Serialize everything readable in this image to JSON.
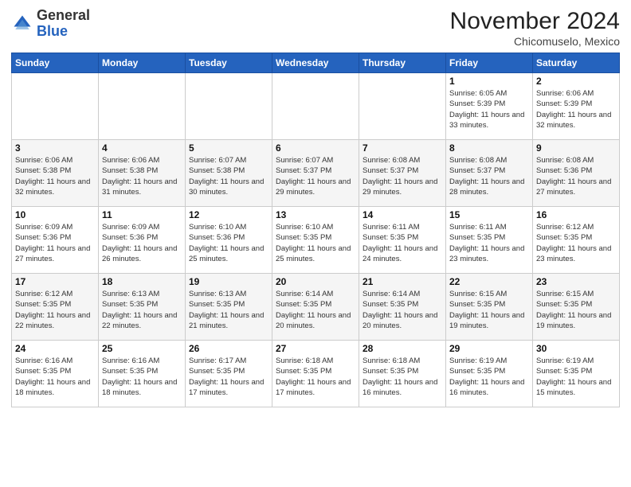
{
  "header": {
    "logo_general": "General",
    "logo_blue": "Blue",
    "month_title": "November 2024",
    "location": "Chicomuselo, Mexico"
  },
  "days_of_week": [
    "Sunday",
    "Monday",
    "Tuesday",
    "Wednesday",
    "Thursday",
    "Friday",
    "Saturday"
  ],
  "weeks": [
    [
      {
        "day": "",
        "info": ""
      },
      {
        "day": "",
        "info": ""
      },
      {
        "day": "",
        "info": ""
      },
      {
        "day": "",
        "info": ""
      },
      {
        "day": "",
        "info": ""
      },
      {
        "day": "1",
        "info": "Sunrise: 6:05 AM\nSunset: 5:39 PM\nDaylight: 11 hours and 33 minutes."
      },
      {
        "day": "2",
        "info": "Sunrise: 6:06 AM\nSunset: 5:39 PM\nDaylight: 11 hours and 32 minutes."
      }
    ],
    [
      {
        "day": "3",
        "info": "Sunrise: 6:06 AM\nSunset: 5:38 PM\nDaylight: 11 hours and 32 minutes."
      },
      {
        "day": "4",
        "info": "Sunrise: 6:06 AM\nSunset: 5:38 PM\nDaylight: 11 hours and 31 minutes."
      },
      {
        "day": "5",
        "info": "Sunrise: 6:07 AM\nSunset: 5:38 PM\nDaylight: 11 hours and 30 minutes."
      },
      {
        "day": "6",
        "info": "Sunrise: 6:07 AM\nSunset: 5:37 PM\nDaylight: 11 hours and 29 minutes."
      },
      {
        "day": "7",
        "info": "Sunrise: 6:08 AM\nSunset: 5:37 PM\nDaylight: 11 hours and 29 minutes."
      },
      {
        "day": "8",
        "info": "Sunrise: 6:08 AM\nSunset: 5:37 PM\nDaylight: 11 hours and 28 minutes."
      },
      {
        "day": "9",
        "info": "Sunrise: 6:08 AM\nSunset: 5:36 PM\nDaylight: 11 hours and 27 minutes."
      }
    ],
    [
      {
        "day": "10",
        "info": "Sunrise: 6:09 AM\nSunset: 5:36 PM\nDaylight: 11 hours and 27 minutes."
      },
      {
        "day": "11",
        "info": "Sunrise: 6:09 AM\nSunset: 5:36 PM\nDaylight: 11 hours and 26 minutes."
      },
      {
        "day": "12",
        "info": "Sunrise: 6:10 AM\nSunset: 5:36 PM\nDaylight: 11 hours and 25 minutes."
      },
      {
        "day": "13",
        "info": "Sunrise: 6:10 AM\nSunset: 5:35 PM\nDaylight: 11 hours and 25 minutes."
      },
      {
        "day": "14",
        "info": "Sunrise: 6:11 AM\nSunset: 5:35 PM\nDaylight: 11 hours and 24 minutes."
      },
      {
        "day": "15",
        "info": "Sunrise: 6:11 AM\nSunset: 5:35 PM\nDaylight: 11 hours and 23 minutes."
      },
      {
        "day": "16",
        "info": "Sunrise: 6:12 AM\nSunset: 5:35 PM\nDaylight: 11 hours and 23 minutes."
      }
    ],
    [
      {
        "day": "17",
        "info": "Sunrise: 6:12 AM\nSunset: 5:35 PM\nDaylight: 11 hours and 22 minutes."
      },
      {
        "day": "18",
        "info": "Sunrise: 6:13 AM\nSunset: 5:35 PM\nDaylight: 11 hours and 22 minutes."
      },
      {
        "day": "19",
        "info": "Sunrise: 6:13 AM\nSunset: 5:35 PM\nDaylight: 11 hours and 21 minutes."
      },
      {
        "day": "20",
        "info": "Sunrise: 6:14 AM\nSunset: 5:35 PM\nDaylight: 11 hours and 20 minutes."
      },
      {
        "day": "21",
        "info": "Sunrise: 6:14 AM\nSunset: 5:35 PM\nDaylight: 11 hours and 20 minutes."
      },
      {
        "day": "22",
        "info": "Sunrise: 6:15 AM\nSunset: 5:35 PM\nDaylight: 11 hours and 19 minutes."
      },
      {
        "day": "23",
        "info": "Sunrise: 6:15 AM\nSunset: 5:35 PM\nDaylight: 11 hours and 19 minutes."
      }
    ],
    [
      {
        "day": "24",
        "info": "Sunrise: 6:16 AM\nSunset: 5:35 PM\nDaylight: 11 hours and 18 minutes."
      },
      {
        "day": "25",
        "info": "Sunrise: 6:16 AM\nSunset: 5:35 PM\nDaylight: 11 hours and 18 minutes."
      },
      {
        "day": "26",
        "info": "Sunrise: 6:17 AM\nSunset: 5:35 PM\nDaylight: 11 hours and 17 minutes."
      },
      {
        "day": "27",
        "info": "Sunrise: 6:18 AM\nSunset: 5:35 PM\nDaylight: 11 hours and 17 minutes."
      },
      {
        "day": "28",
        "info": "Sunrise: 6:18 AM\nSunset: 5:35 PM\nDaylight: 11 hours and 16 minutes."
      },
      {
        "day": "29",
        "info": "Sunrise: 6:19 AM\nSunset: 5:35 PM\nDaylight: 11 hours and 16 minutes."
      },
      {
        "day": "30",
        "info": "Sunrise: 6:19 AM\nSunset: 5:35 PM\nDaylight: 11 hours and 15 minutes."
      }
    ]
  ]
}
